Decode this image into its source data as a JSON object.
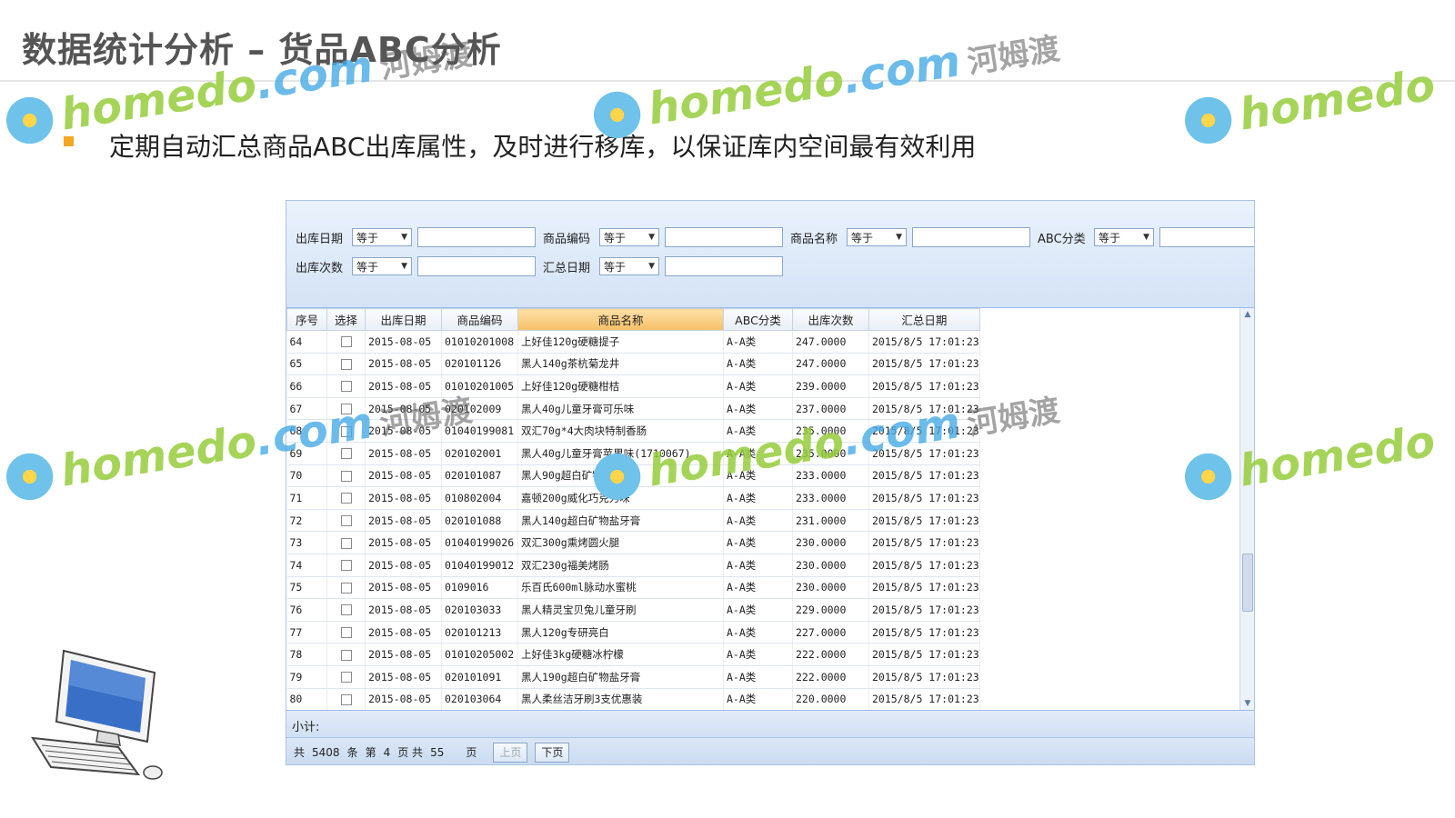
{
  "slide": {
    "title": "数据统计分析 – 货品ABC分析",
    "bullet": "定期自动汇总商品ABC出库属性，及时进行移库，以保证库内空间最有效利用"
  },
  "filters": {
    "row1": [
      {
        "label": "出库日期",
        "operator": "等于",
        "value": ""
      },
      {
        "label": "商品编码",
        "operator": "等于",
        "value": ""
      },
      {
        "label": "商品名称",
        "operator": "等于",
        "value": ""
      },
      {
        "label": "ABC分类",
        "operator": "等于",
        "value": ""
      }
    ],
    "row2": [
      {
        "label": "出库次数",
        "operator": "等于",
        "value": ""
      },
      {
        "label": "汇总日期",
        "operator": "等于",
        "value": ""
      }
    ]
  },
  "grid": {
    "columns": [
      "序号",
      "选择",
      "出库日期",
      "商品编码",
      "商品名称",
      "ABC分类",
      "出库次数",
      "汇总日期"
    ],
    "sorted_column": "商品名称",
    "rows": [
      [
        "64",
        "2015-08-05",
        "01010201008",
        "上好佳120g硬糖提子",
        "A-A类",
        "247.0000",
        "2015/8/5 17:01:23"
      ],
      [
        "65",
        "2015-08-05",
        "020101126",
        "黑人140g茶杭菊龙井",
        "A-A类",
        "247.0000",
        "2015/8/5 17:01:23"
      ],
      [
        "66",
        "2015-08-05",
        "01010201005",
        "上好佳120g硬糖柑桔",
        "A-A类",
        "239.0000",
        "2015/8/5 17:01:23"
      ],
      [
        "67",
        "2015-08-05",
        "020102009",
        "黑人40g儿童牙膏可乐味",
        "A-A类",
        "237.0000",
        "2015/8/5 17:01:23"
      ],
      [
        "68",
        "2015-08-05",
        "01040199081",
        "双汇70g*4大肉块特制香肠",
        "A-A类",
        "235.0000",
        "2015/8/5 17:01:23"
      ],
      [
        "69",
        "2015-08-05",
        "020102001",
        "黑人40g儿童牙膏苹果味(1710067)",
        "A-A类",
        "235.0000",
        "2015/8/5 17:01:23"
      ],
      [
        "70",
        "2015-08-05",
        "020101087",
        "黑人90g超白矿物盐牙膏",
        "A-A类",
        "233.0000",
        "2015/8/5 17:01:23"
      ],
      [
        "71",
        "2015-08-05",
        "010802004",
        "嘉顿200g威化巧克力味",
        "A-A类",
        "233.0000",
        "2015/8/5 17:01:23"
      ],
      [
        "72",
        "2015-08-05",
        "020101088",
        "黑人140g超白矿物盐牙膏",
        "A-A类",
        "231.0000",
        "2015/8/5 17:01:23"
      ],
      [
        "73",
        "2015-08-05",
        "01040199026",
        "双汇300g熏烤圆火腿",
        "A-A类",
        "230.0000",
        "2015/8/5 17:01:23"
      ],
      [
        "74",
        "2015-08-05",
        "01040199012",
        "双汇230g福美烤肠",
        "A-A类",
        "230.0000",
        "2015/8/5 17:01:23"
      ],
      [
        "75",
        "2015-08-05",
        "0109016",
        "乐百氏600ml脉动水蜜桃",
        "A-A类",
        "230.0000",
        "2015/8/5 17:01:23"
      ],
      [
        "76",
        "2015-08-05",
        "020103033",
        "黑人精灵宝贝兔儿童牙刷",
        "A-A类",
        "229.0000",
        "2015/8/5 17:01:23"
      ],
      [
        "77",
        "2015-08-05",
        "020101213",
        "黑人120g专研亮白",
        "A-A类",
        "227.0000",
        "2015/8/5 17:01:23"
      ],
      [
        "78",
        "2015-08-05",
        "01010205002",
        "上好佳3kg硬糖冰柠檬",
        "A-A类",
        "222.0000",
        "2015/8/5 17:01:23"
      ],
      [
        "79",
        "2015-08-05",
        "020101091",
        "黑人190g超白矿物盐牙膏",
        "A-A类",
        "222.0000",
        "2015/8/5 17:01:23"
      ],
      [
        "80",
        "2015-08-05",
        "020103064",
        "黑人柔丝洁牙刷3支优惠装",
        "A-A类",
        "220.0000",
        "2015/8/5 17:01:23"
      ]
    ]
  },
  "subtotal": {
    "label": "小计:"
  },
  "pager": {
    "total_prefix": "共",
    "total": "5408",
    "total_suffix": "条",
    "page_prefix": "第",
    "page": "4",
    "page_mid": "页 共",
    "pages": "55",
    "page_suffix": "页",
    "prev_label": "上页",
    "next_label": "下页"
  },
  "watermark": {
    "latin": "homedo",
    "dot": ".com",
    "chinese": "河姆渡"
  },
  "colors": {
    "accent_bullet": "#f5a623",
    "sorted_header": "#f8c067",
    "panel_blue": "#d4e3f6"
  }
}
